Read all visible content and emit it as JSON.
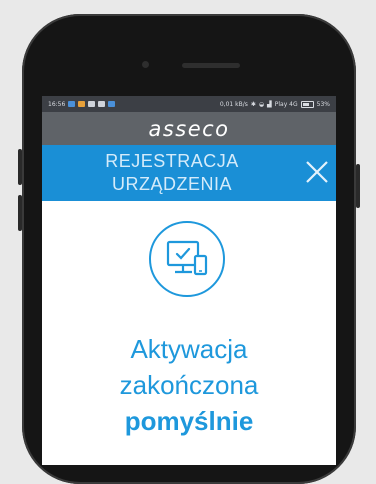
{
  "status_bar": {
    "time": "16:56",
    "network_speed": "0,01 kB/s",
    "carrier": "Play 4G",
    "battery": "53%"
  },
  "brand": {
    "logo_text": "asseco"
  },
  "header": {
    "title_line1": "REJESTRACJA",
    "title_line2": "URZĄDZENIA",
    "close_icon": "close-icon"
  },
  "content": {
    "icon": "device-check-icon",
    "message_line1": "Aktywacja",
    "message_line2": "zakończona",
    "message_line3": "pomyślnie"
  },
  "colors": {
    "accent": "#1a8fd6",
    "brand_bar": "#5f6368",
    "status_bar": "#3c3f45",
    "text_accent": "#1e98dc"
  }
}
